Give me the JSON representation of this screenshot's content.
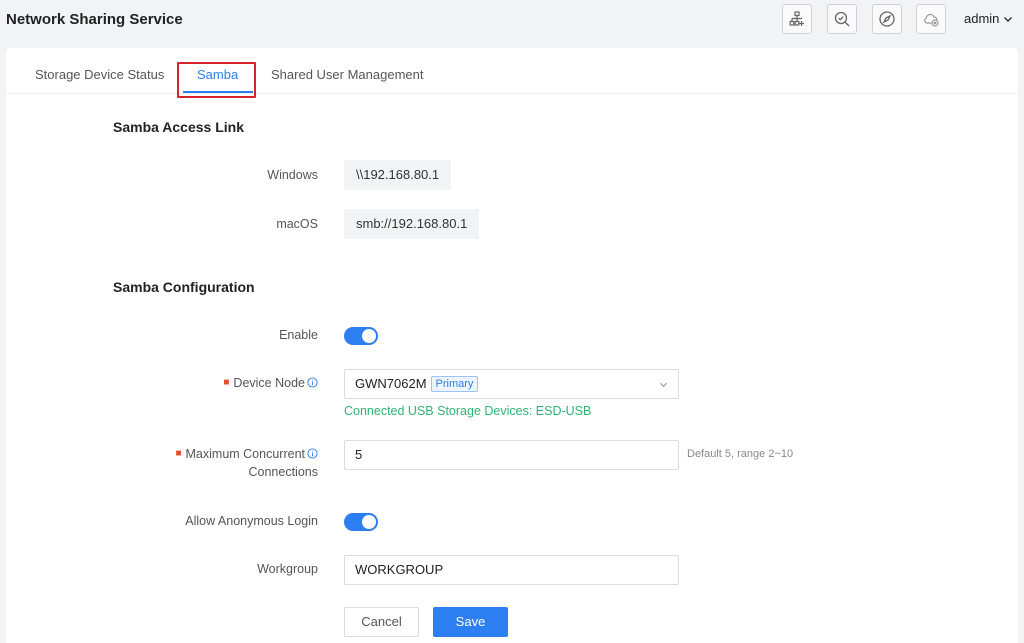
{
  "header": {
    "title": "Network Sharing Service",
    "user": "admin",
    "icons": [
      "topology-add-icon",
      "search-refresh-icon",
      "compass-icon",
      "cloud-offline-icon"
    ]
  },
  "tabs": [
    {
      "label": "Storage Device Status",
      "active": false
    },
    {
      "label": "Samba",
      "active": true
    },
    {
      "label": "Shared User Management",
      "active": false
    }
  ],
  "access_link": {
    "title": "Samba Access Link",
    "windows_label": "Windows",
    "windows_value": "\\\\192.168.80.1",
    "macos_label": "macOS",
    "macos_value": "smb://192.168.80.1"
  },
  "config": {
    "title": "Samba Configuration",
    "enable_label": "Enable",
    "enable_on": true,
    "device_node_label": "Device Node",
    "device_node_value": "GWN7062M",
    "device_node_tag": "Primary",
    "connected_text": "Connected USB Storage Devices: ESD-USB",
    "max_conn_label_1": "Maximum Concurrent",
    "max_conn_label_2": "Connections",
    "max_conn_value": "5",
    "max_conn_hint": "Default 5, range 2~10",
    "anon_label": "Allow Anonymous Login",
    "anon_on": true,
    "workgroup_label": "Workgroup",
    "workgroup_value": "WORKGROUP"
  },
  "actions": {
    "cancel": "Cancel",
    "save": "Save"
  },
  "colors": {
    "accent": "#2d7ef0",
    "success": "#2bb673",
    "highlight": "#d9232a"
  }
}
